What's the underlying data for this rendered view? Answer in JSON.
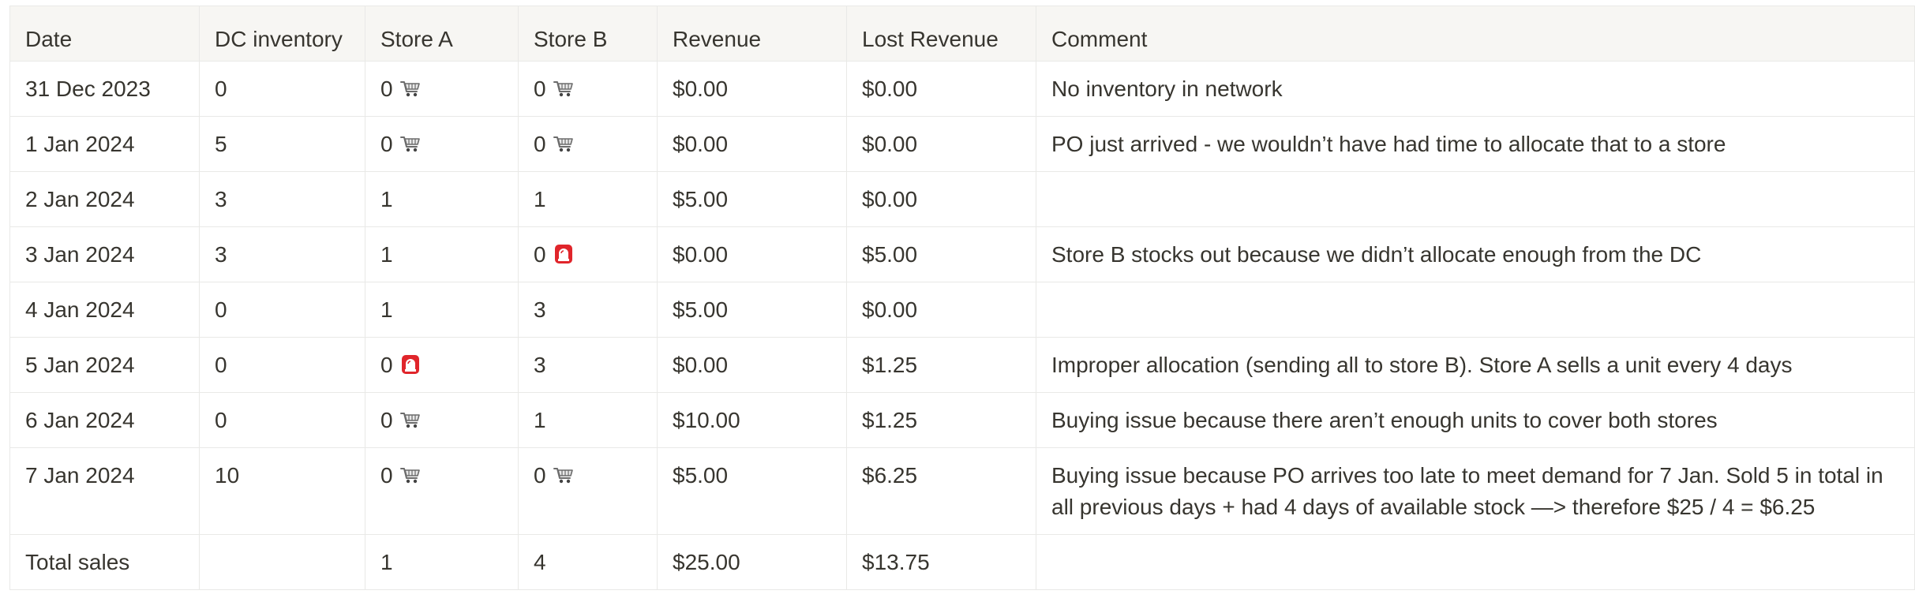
{
  "table": {
    "headers": [
      "Date",
      "DC inventory",
      "Store A",
      "Store B",
      "Revenue",
      "Lost Revenue",
      "Comment"
    ],
    "rows": [
      {
        "date": "31 Dec 2023",
        "dc": "0",
        "a": "0",
        "a_icon": "cart-icon",
        "b": "0",
        "b_icon": "cart-icon",
        "revenue": "$0.00",
        "lost": "$0.00",
        "comment": "No inventory in network"
      },
      {
        "date": "1 Jan 2024",
        "dc": "5",
        "a": "0",
        "a_icon": "cart-icon",
        "b": "0",
        "b_icon": "cart-icon",
        "revenue": "$0.00",
        "lost": "$0.00",
        "comment": "PO just arrived - we wouldn’t have had time to allocate that to a store"
      },
      {
        "date": "2 Jan 2024",
        "dc": "3",
        "a": "1",
        "a_icon": "",
        "b": "1",
        "b_icon": "",
        "revenue": "$5.00",
        "lost": "$0.00",
        "comment": ""
      },
      {
        "date": "3 Jan 2024",
        "dc": "3",
        "a": "1",
        "a_icon": "",
        "b": "0",
        "b_icon": "siren-icon",
        "revenue": "$0.00",
        "lost": "$5.00",
        "comment": "Store B stocks out because we didn’t allocate enough from the DC"
      },
      {
        "date": "4 Jan 2024",
        "dc": "0",
        "a": "1",
        "a_icon": "",
        "b": "3",
        "b_icon": "",
        "revenue": "$5.00",
        "lost": "$0.00",
        "comment": ""
      },
      {
        "date": "5 Jan 2024",
        "dc": "0",
        "a": "0",
        "a_icon": "siren-icon",
        "b": "3",
        "b_icon": "",
        "revenue": "$0.00",
        "lost": "$1.25",
        "comment": "Improper allocation (sending all to store B). Store A sells a unit every 4 days"
      },
      {
        "date": "6 Jan 2024",
        "dc": "0",
        "a": "0",
        "a_icon": "cart-icon",
        "b": "1",
        "b_icon": "",
        "revenue": "$10.00",
        "lost": "$1.25",
        "comment": "Buying issue because there aren’t enough units to cover both stores"
      },
      {
        "date": "7 Jan 2024",
        "dc": "10",
        "a": "0",
        "a_icon": "cart-icon",
        "b": "0",
        "b_icon": "cart-icon",
        "revenue": "$5.00",
        "lost": "$6.25",
        "comment": "Buying issue because PO arrives too late to meet demand for 7 Jan. Sold 5 in total in all previous days + had 4 days of available stock —> therefore $25 / 4 = $6.25"
      },
      {
        "date": "Total sales",
        "dc": "",
        "a": "1",
        "a_icon": "",
        "b": "4",
        "b_icon": "",
        "revenue": "$25.00",
        "lost": "$13.75",
        "comment": ""
      }
    ]
  },
  "colors": {
    "header_bg": "#f7f6f3",
    "border": "#e9e9e7",
    "text": "#37352f",
    "siren_red": "#e0252b"
  }
}
